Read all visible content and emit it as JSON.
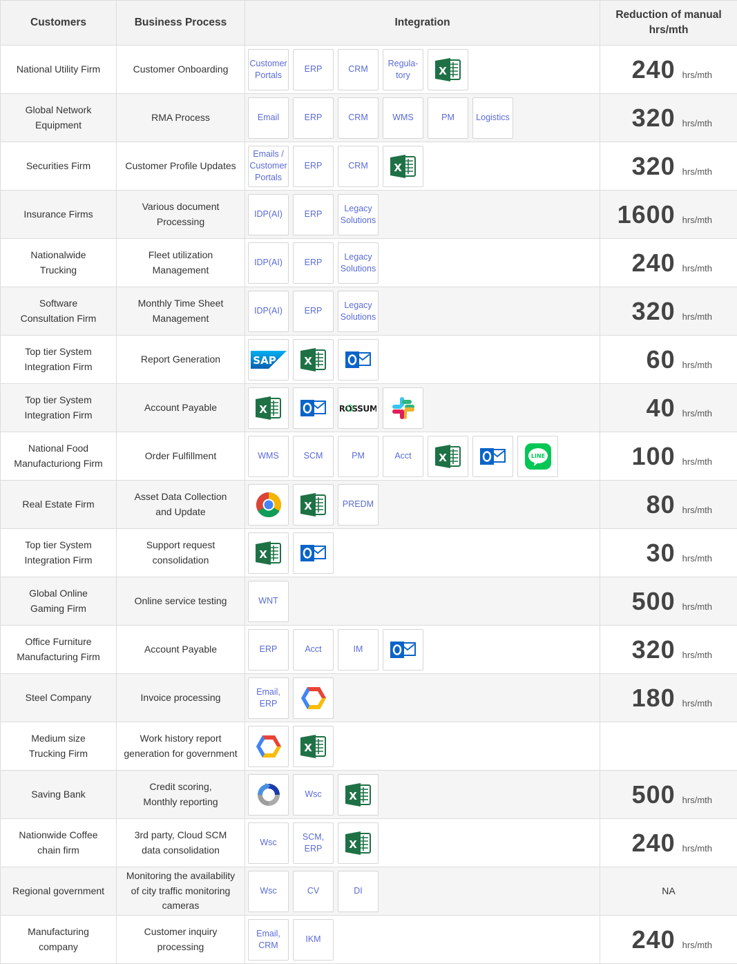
{
  "headers": {
    "customers": "Customers",
    "process": "Business Process",
    "integration": "Integration",
    "reduction": "Reduction of manual hrs/mth"
  },
  "unit": "hrs/mth",
  "colors": {
    "link_text": "#5a6bd8",
    "header_bg": "#f3f3f3",
    "excel_green": "#1e7145",
    "outlook_blue": "#0a64c8"
  },
  "rows": [
    {
      "customer": "National Utility Firm",
      "process": "Customer Onboarding",
      "items": [
        {
          "text": "Customer\nPortals"
        },
        {
          "text": "ERP"
        },
        {
          "text": "CRM"
        },
        {
          "text": "Regula-\ntory"
        },
        {
          "icon": "excel-icon"
        }
      ],
      "value": "240"
    },
    {
      "customer": "Global Network\nEquipment",
      "process": "RMA Process",
      "items": [
        {
          "text": "Email"
        },
        {
          "text": "ERP"
        },
        {
          "text": "CRM"
        },
        {
          "text": "WMS"
        },
        {
          "text": "PM"
        },
        {
          "text": "Logistics"
        }
      ],
      "value": "320"
    },
    {
      "customer": "Securities Firm",
      "process": "Customer Profile Updates",
      "items": [
        {
          "text": "Emails /\nCustomer\nPortals"
        },
        {
          "text": "ERP"
        },
        {
          "text": "CRM"
        },
        {
          "icon": "excel-icon"
        }
      ],
      "value": "320"
    },
    {
      "customer": "Insurance Firms",
      "process": "Various document\nProcessing",
      "items": [
        {
          "text": "IDP(AI)"
        },
        {
          "text": "ERP"
        },
        {
          "text": "Legacy\nSolutions"
        }
      ],
      "value": "1600"
    },
    {
      "customer": "Nationalwide\nTrucking",
      "process": "Fleet utilization\nManagement",
      "items": [
        {
          "text": "IDP(AI)"
        },
        {
          "text": "ERP"
        },
        {
          "text": "Legacy\nSolutions"
        }
      ],
      "value": "240"
    },
    {
      "customer": "Software\nConsultation Firm",
      "process": "Monthly Time Sheet\nManagement",
      "items": [
        {
          "text": "IDP(AI)"
        },
        {
          "text": "ERP"
        },
        {
          "text": "Legacy\nSolutions"
        }
      ],
      "value": "320"
    },
    {
      "customer": "Top tier System\nIntegration Firm",
      "process": "Report Generation",
      "items": [
        {
          "icon": "sap-icon",
          "label": "SAP"
        },
        {
          "icon": "excel-icon"
        },
        {
          "icon": "outlook-icon"
        }
      ],
      "value": "60"
    },
    {
      "customer": "Top tier System\nIntegration Firm",
      "process": "Account Payable",
      "items": [
        {
          "icon": "excel-icon"
        },
        {
          "icon": "outlook-icon"
        },
        {
          "icon": "rossum-icon",
          "label": "ROSSUM"
        },
        {
          "icon": "slack-icon"
        }
      ],
      "value": "40"
    },
    {
      "customer": "National Food\nManufacturiong Firm",
      "process": "Order Fulfillment",
      "items": [
        {
          "text": "WMS"
        },
        {
          "text": "SCM"
        },
        {
          "text": "PM"
        },
        {
          "text": "Acct"
        },
        {
          "icon": "excel-icon"
        },
        {
          "icon": "outlook-icon"
        },
        {
          "icon": "line-icon",
          "label": "LINE"
        }
      ],
      "value": "100"
    },
    {
      "customer": "Real Estate Firm",
      "process": "Asset Data Collection\nand Update",
      "items": [
        {
          "icon": "chrome-icon"
        },
        {
          "icon": "excel-icon"
        },
        {
          "text": "PREDM"
        }
      ],
      "value": "80"
    },
    {
      "customer": "Top tier System\nIntegration Firm",
      "process": "Support request\nconsolidation",
      "items": [
        {
          "icon": "excel-icon"
        },
        {
          "icon": "outlook-icon"
        }
      ],
      "value": "30"
    },
    {
      "customer": "Global Online\nGaming Firm",
      "process": "Online service testing",
      "items": [
        {
          "text": "WNT"
        }
      ],
      "value": "500"
    },
    {
      "customer": "Office Furniture\nManufacturing Firm",
      "process": "Account Payable",
      "items": [
        {
          "text": "ERP"
        },
        {
          "text": "Acct"
        },
        {
          "text": "IM"
        },
        {
          "icon": "outlook-icon"
        }
      ],
      "value": "320"
    },
    {
      "customer": "Steel Company",
      "process": "Invoice processing",
      "items": [
        {
          "text": "Email,\nERP"
        },
        {
          "icon": "google-cloud-icon"
        }
      ],
      "value": "180"
    },
    {
      "customer": "Medium size\nTrucking Firm",
      "process": "Work history report\ngeneration for government",
      "items": [
        {
          "icon": "google-cloud-icon"
        },
        {
          "icon": "excel-icon"
        }
      ],
      "value": ""
    },
    {
      "customer": "Saving Bank",
      "process": "Credit scoring,\nMonthly reporting",
      "items": [
        {
          "icon": "recaptcha-icon"
        },
        {
          "text": "Wsc"
        },
        {
          "icon": "excel-icon"
        }
      ],
      "value": "500"
    },
    {
      "customer": "Nationwide Coffee\nchain firm",
      "process": "3rd party, Cloud SCM\ndata consolidation",
      "items": [
        {
          "text": "Wsc"
        },
        {
          "text": "SCM,\nERP"
        },
        {
          "icon": "excel-icon"
        }
      ],
      "value": "240"
    },
    {
      "customer": "Regional government",
      "process": "Monitoring the availability\nof city traffic monitoring\ncameras",
      "items": [
        {
          "text": "Wsc"
        },
        {
          "text": "CV"
        },
        {
          "text": "DI"
        }
      ],
      "value": "",
      "note": "NA"
    },
    {
      "customer": "Manufacturing\ncompany",
      "process": "Customer inquiry\nprocessing",
      "items": [
        {
          "text": "Email,\nCRM"
        },
        {
          "text": "IKM"
        }
      ],
      "value": "240"
    }
  ]
}
